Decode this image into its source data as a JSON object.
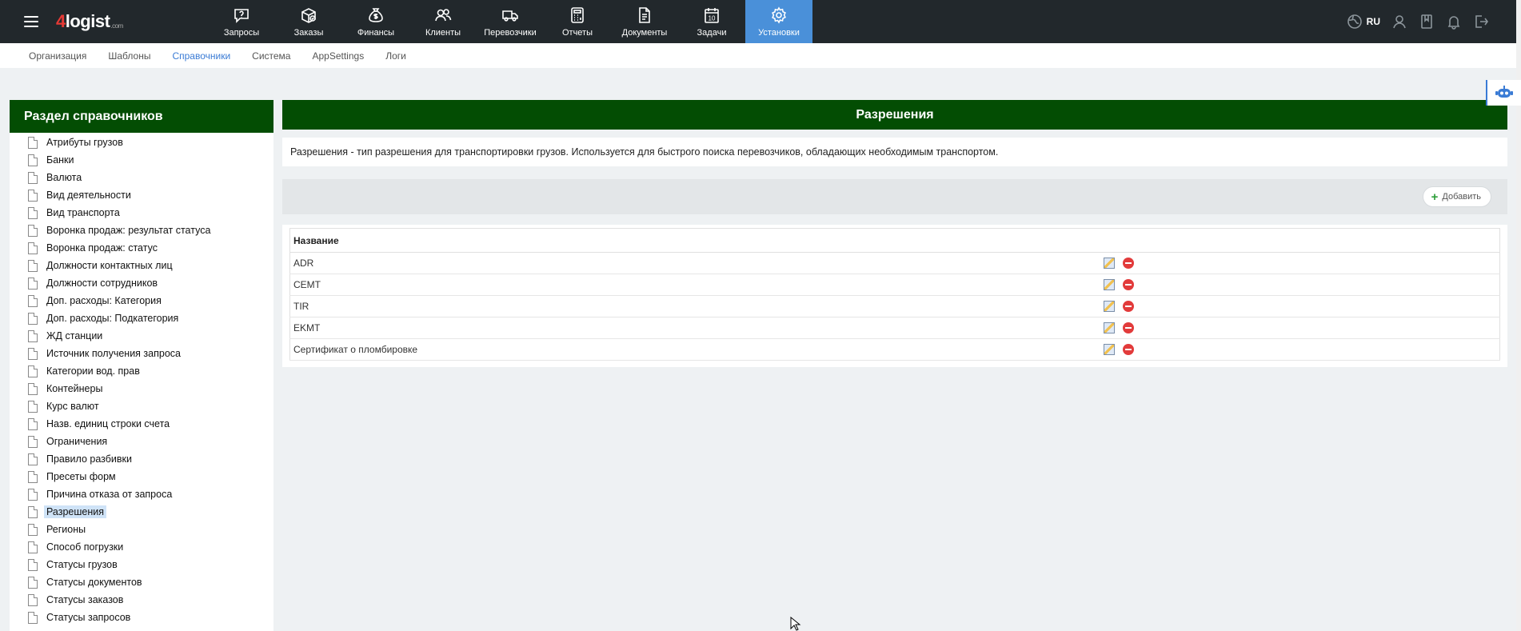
{
  "logo": {
    "prefix": "4",
    "name": "logist",
    "suffix": ".com"
  },
  "nav": [
    {
      "label": "Запросы",
      "icon": "chat-question-icon",
      "active": false
    },
    {
      "label": "Заказы",
      "icon": "box-check-icon",
      "active": false
    },
    {
      "label": "Финансы",
      "icon": "money-bag-icon",
      "active": false
    },
    {
      "label": "Клиенты",
      "icon": "users-icon",
      "active": false
    },
    {
      "label": "Перевозчики",
      "icon": "truck-icon",
      "active": false
    },
    {
      "label": "Отчеты",
      "icon": "calculator-icon",
      "active": false
    },
    {
      "label": "Документы",
      "icon": "document-icon",
      "active": false
    },
    {
      "label": "Задачи",
      "icon": "calendar-icon",
      "active": false
    },
    {
      "label": "Установки",
      "icon": "gear-icon",
      "active": true
    }
  ],
  "lang": "RU",
  "subnav": [
    {
      "label": "Организация",
      "active": false
    },
    {
      "label": "Шаблоны",
      "active": false
    },
    {
      "label": "Справочники",
      "active": true
    },
    {
      "label": "Система",
      "active": false
    },
    {
      "label": "AppSettings",
      "active": false
    },
    {
      "label": "Логи",
      "active": false
    }
  ],
  "sidebar": {
    "title": "Раздел справочников",
    "items": [
      {
        "label": "Атрибуты грузов"
      },
      {
        "label": "Банки"
      },
      {
        "label": "Валюта"
      },
      {
        "label": "Вид деятельности"
      },
      {
        "label": "Вид транспорта"
      },
      {
        "label": "Воронка продаж: результат статуса"
      },
      {
        "label": "Воронка продаж: статус"
      },
      {
        "label": "Должности контактных лиц"
      },
      {
        "label": "Должности сотрудников"
      },
      {
        "label": "Доп. расходы: Категория"
      },
      {
        "label": "Доп. расходы: Подкатегория"
      },
      {
        "label": "ЖД станции"
      },
      {
        "label": "Источник получения запроса"
      },
      {
        "label": "Категории вод. прав"
      },
      {
        "label": "Контейнеры"
      },
      {
        "label": "Курс валют"
      },
      {
        "label": "Назв. единиц строки счета"
      },
      {
        "label": "Ограничения"
      },
      {
        "label": "Правило разбивки"
      },
      {
        "label": "Пресеты форм"
      },
      {
        "label": "Причина отказа от запроса"
      },
      {
        "label": "Разрешения",
        "selected": true
      },
      {
        "label": "Регионы"
      },
      {
        "label": "Способ погрузки"
      },
      {
        "label": "Статусы грузов"
      },
      {
        "label": "Статусы документов"
      },
      {
        "label": "Статусы заказов"
      },
      {
        "label": "Статусы запросов"
      }
    ]
  },
  "main": {
    "title": "Разрешения",
    "description": "Разрешения - тип разрешения для транспортировки грузов. Используется для быстрого поиска перевозчиков, обладающих необходимым транспортом.",
    "add_label": "Добавить",
    "column_name": "Название",
    "rows": [
      {
        "name": "ADR"
      },
      {
        "name": "CEMT"
      },
      {
        "name": "TIR"
      },
      {
        "name": "EKMT"
      },
      {
        "name": "Сертификат о пломбировке"
      }
    ]
  }
}
